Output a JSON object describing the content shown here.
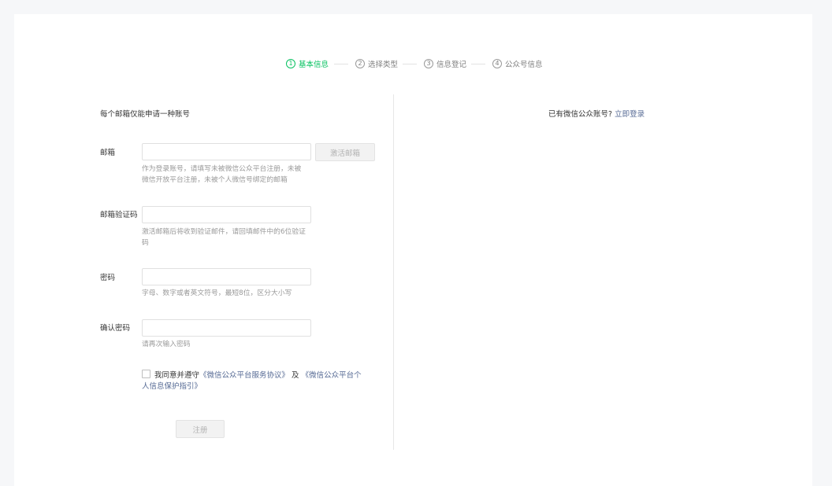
{
  "steps": [
    {
      "num": "1",
      "label": "基本信息",
      "active": true
    },
    {
      "num": "2",
      "label": "选择类型",
      "active": false
    },
    {
      "num": "3",
      "label": "信息登记",
      "active": false
    },
    {
      "num": "4",
      "label": "公众号信息",
      "active": false
    }
  ],
  "notice": "每个邮箱仅能申请一种账号",
  "login": {
    "prompt": "已有微信公众账号?",
    "link": "立即登录"
  },
  "form": {
    "email": {
      "label": "邮箱",
      "value": "",
      "hint": "作为登录账号，请填写未被微信公众平台注册，未被微信开放平台注册，未被个人微信号绑定的邮箱",
      "activate_label": "激活邮箱"
    },
    "code": {
      "label": "邮箱验证码",
      "value": "",
      "hint": "激活邮箱后将收到验证邮件，请回填邮件中的6位验证码"
    },
    "password": {
      "label": "密码",
      "value": "",
      "hint": "字母、数字或者英文符号，最短8位，区分大小写"
    },
    "confirm": {
      "label": "确认密码",
      "value": "",
      "hint": "请再次输入密码"
    }
  },
  "agreement": {
    "prefix": "我同意并遵守",
    "link1": "《微信公众平台服务协议》",
    "middle": " 及 ",
    "link2": "《微信公众平台个人信息保护指引》",
    "checked": false
  },
  "register_label": "注册",
  "colors": {
    "accent": "#07c160",
    "link": "#576b95"
  }
}
